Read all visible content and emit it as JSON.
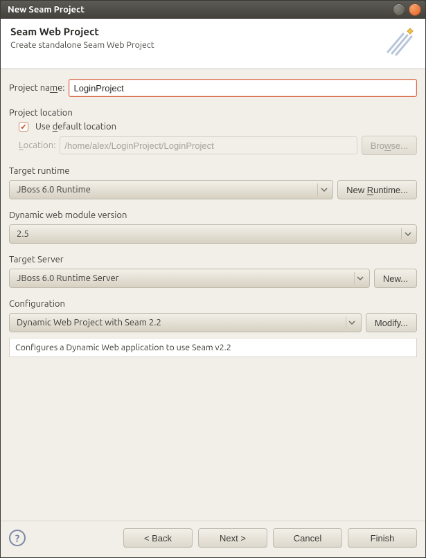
{
  "window": {
    "title": "New Seam Project"
  },
  "banner": {
    "title": "Seam Web Project",
    "subtitle": "Create standalone Seam Web Project"
  },
  "project_name": {
    "label_pre": "Project na",
    "label_u": "m",
    "label_post": "e:",
    "value": "LoginProject"
  },
  "project_location": {
    "title": "Project location",
    "use_default_pre": "Use ",
    "use_default_u": "d",
    "use_default_post": "efault location",
    "checked": true,
    "location_label_u": "L",
    "location_label_post": "ocation:",
    "location_value": "/home/alex/LoginProject/LoginProject",
    "browse_pre": "Bro",
    "browse_u": "w",
    "browse_post": "se..."
  },
  "target_runtime": {
    "title": "Target runtime",
    "value": "JBoss 6.0 Runtime",
    "new_pre": "New ",
    "new_u": "R",
    "new_post": "untime..."
  },
  "web_module": {
    "title": "Dynamic web module version",
    "value": "2.5"
  },
  "target_server": {
    "title": "Target Server",
    "value": "JBoss 6.0 Runtime Server",
    "new": "New..."
  },
  "configuration": {
    "title": "Configuration",
    "value": "Dynamic Web Project with Seam 2.2",
    "modify": "Modify...",
    "description": "Configures a Dynamic Web application to use Seam v2.2"
  },
  "footer": {
    "back": "< Back",
    "next": "Next >",
    "cancel": "Cancel",
    "finish": "Finish"
  }
}
